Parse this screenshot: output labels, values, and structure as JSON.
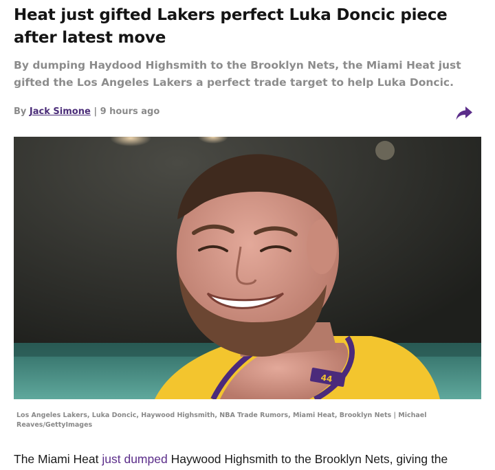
{
  "article": {
    "headline": "Heat just gifted Lakers perfect Luka Doncic piece after latest move",
    "dek": "By dumping Haydood Highsmith to the Brooklyn Nets, the Miami Heat just gifted the Los Angeles Lakers a perfect trade target to help Luka Doncic.",
    "byline": {
      "prefix": "By",
      "author": "Jack Simone",
      "separator": "|",
      "time": "9 hours ago"
    },
    "share_icon": "share-arrow-icon",
    "image": {
      "jersey_number": "44"
    },
    "caption": "Los Angeles Lakers, Luka Doncic, Haywood Highsmith, NBA Trade Rumors, Miami Heat, Brooklyn Nets | Michael Reaves/GettyImages",
    "body": {
      "before_link": "The Miami Heat ",
      "link_text": "just dumped",
      "after_link": " Haywood Highsmith to the Brooklyn Nets, giving the"
    }
  },
  "colors": {
    "link": "#4a2c78",
    "share_icon": "#5b2d8a",
    "dek": "#8c8c8c",
    "jersey_gold": "#f3c52e",
    "jersey_purple": "#4b2a7b"
  }
}
